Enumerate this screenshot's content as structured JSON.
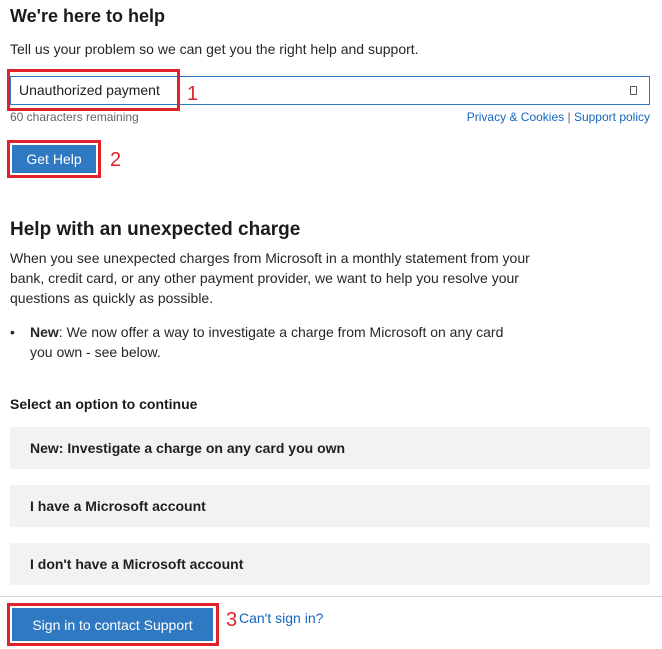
{
  "header": {
    "title": "We're here to help",
    "subtitle": "Tell us your problem so we can get you the right help and support."
  },
  "search": {
    "value": "Unauthorized payment",
    "chars_remaining": "60 characters remaining"
  },
  "links": {
    "privacy": "Privacy & Cookies",
    "separator": "|",
    "support_policy": "Support policy"
  },
  "actions": {
    "get_help": "Get Help",
    "sign_in": "Sign in to contact Support",
    "cant_sign_in": "Can't sign in?"
  },
  "annotations": {
    "one": "1",
    "two": "2",
    "three": "3"
  },
  "section": {
    "title": "Help with an unexpected charge",
    "paragraph": "When you see unexpected charges from Microsoft in a monthly statement from your bank, credit card, or any other payment provider, we want to help you resolve your questions as quickly as possible.",
    "bullet_label": "New",
    "bullet_text": ": We now offer a way to investigate a charge from Microsoft on any card you own - see below."
  },
  "options": {
    "label": "Select an option to continue",
    "items": [
      "New: Investigate a charge on any card you own",
      "I have a Microsoft account",
      "I don't have a Microsoft account"
    ]
  },
  "colors": {
    "accent": "#2f79c2",
    "annotation": "#e0232a",
    "link": "#1565c0"
  }
}
